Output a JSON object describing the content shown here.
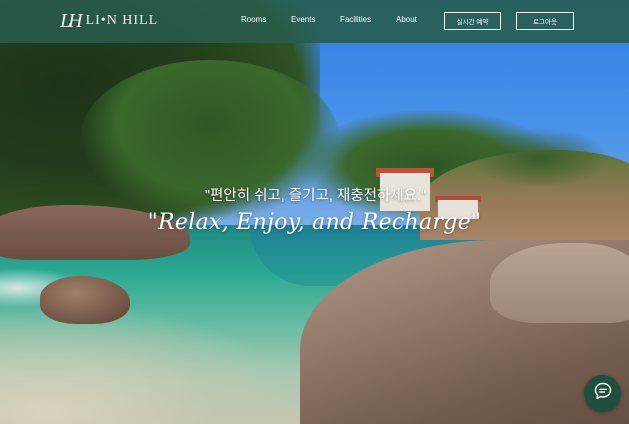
{
  "header": {
    "logo_mark": "LH",
    "logo_text": "LI•N HILL",
    "nav": {
      "rooms": "Rooms",
      "events": "Events",
      "facilities": "Facilities",
      "about": "About"
    },
    "reserve_label": "실시간 예약",
    "logout_label": "로그아웃"
  },
  "hero": {
    "headline_ko": "\"편안히 쉬고, 즐기고, 재충전하세요.\"",
    "headline_en": "\"Relax, Enjoy, and Recharge\""
  },
  "chat": {
    "icon": "chat-bubble-icon"
  },
  "colors": {
    "header_bg": "#285c4c",
    "chat_bg": "#1f4f3d",
    "text": "#ffffff"
  }
}
